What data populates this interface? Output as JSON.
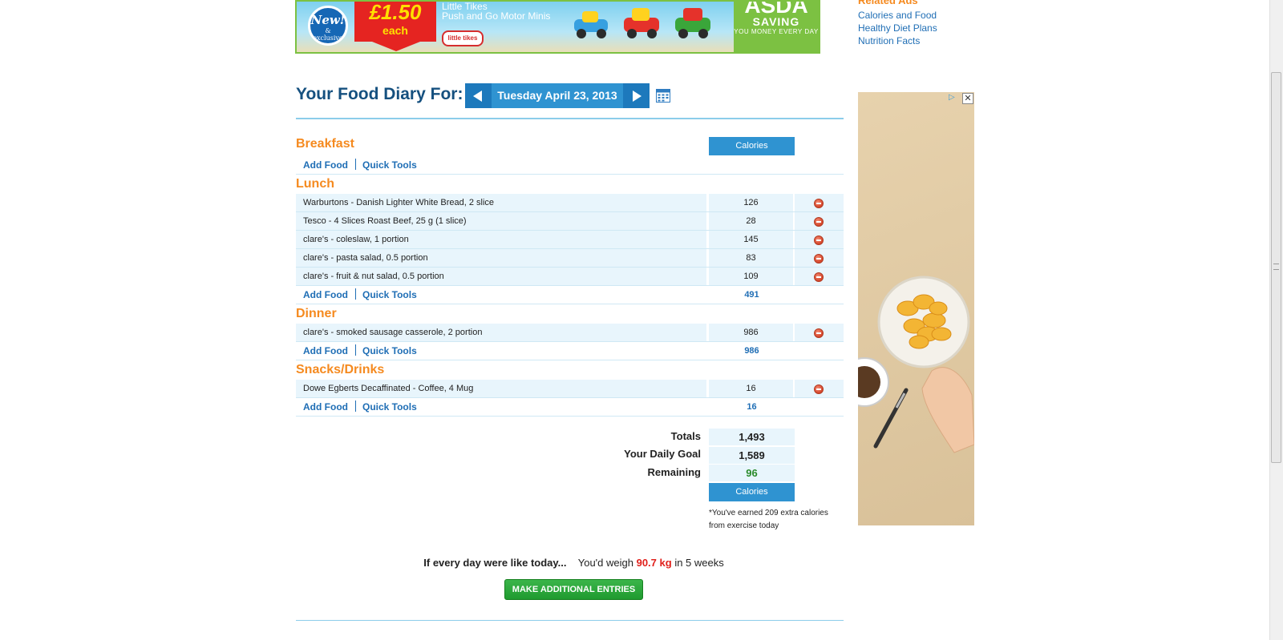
{
  "banner_ad": {
    "new_label": "New!",
    "exclusive_label": "& exclusive",
    "price": "£1.50",
    "price_unit": "each",
    "brand": "Little Tikes",
    "product": "Push and Go Motor Minis",
    "brand_logo": "little tikes",
    "store": "ASDA",
    "store_tagline1": "SAVING",
    "store_tagline2": "YOU MONEY EVERY DAY"
  },
  "related_ads": {
    "title": "Related Ads",
    "links": [
      "Calories and Food",
      "Healthy Diet Plans",
      "Nutrition Facts"
    ]
  },
  "side_ad": {
    "close_label": "✕",
    "info_icon": "adchoices-icon"
  },
  "diary": {
    "title": "Your Food Diary For:",
    "date": "Tuesday April 23, 2013",
    "column_label": "Calories"
  },
  "meals": [
    {
      "name": "Breakfast",
      "items": [],
      "total": ""
    },
    {
      "name": "Lunch",
      "items": [
        {
          "name": "Warburtons - Danish Lighter White Bread, 2 slice",
          "calories": "126"
        },
        {
          "name": "Tesco - 4 Slices Roast Beef, 25 g (1 slice)",
          "calories": "28"
        },
        {
          "name": "clare's - coleslaw, 1 portion",
          "calories": "145"
        },
        {
          "name": "clare's - pasta salad, 0.5 portion",
          "calories": "83"
        },
        {
          "name": "clare's - fruit & nut salad, 0.5 portion",
          "calories": "109"
        }
      ],
      "total": "491"
    },
    {
      "name": "Dinner",
      "items": [
        {
          "name": "clare's - smoked sausage casserole, 2 portion",
          "calories": "986"
        }
      ],
      "total": "986"
    },
    {
      "name": "Snacks/Drinks",
      "items": [
        {
          "name": "Dowe Egberts Decaffinated - Coffee, 4 Mug",
          "calories": "16"
        }
      ],
      "total": "16"
    }
  ],
  "actions": {
    "add_food": "Add Food",
    "quick_tools": "Quick Tools"
  },
  "summary": {
    "totals_label": "Totals",
    "totals_value": "1,493",
    "goal_label": "Your Daily Goal",
    "goal_value": "1,589",
    "remaining_label": "Remaining",
    "remaining_value": "96",
    "column_label": "Calories",
    "exercise_note_line1": "*You've earned 209 extra calories",
    "exercise_note_line2": "from exercise today"
  },
  "projection": {
    "question": "If every day were like today...",
    "prefix": "You'd weigh",
    "weight": "90.7 kg",
    "suffix": "in 5 weeks"
  },
  "make_entries_label": "MAKE ADDITIONAL ENTRIES",
  "colors": {
    "meal_title": "#f58a1f",
    "link": "#1f6eb5",
    "header_blue": "#2f93d1",
    "row_bg": "#e8f5fc",
    "green_button": "#1f9a2f",
    "weight_red": "#e0201b"
  }
}
